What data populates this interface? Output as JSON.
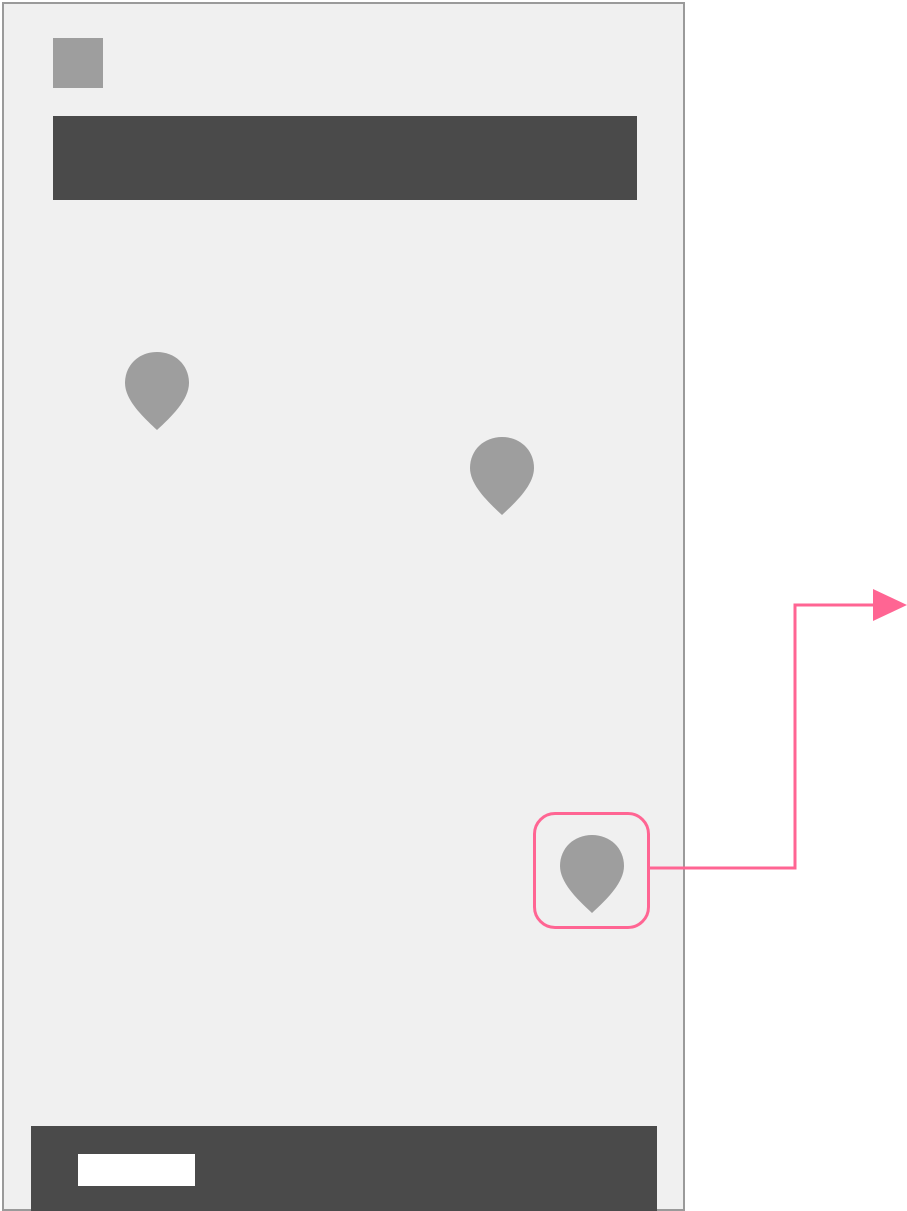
{
  "colors": {
    "screen_background": "#f0f0f0",
    "screen_border": "#9a9a9a",
    "dark_bar": "#4a4a4a",
    "placeholder_gray": "#9e9e9e",
    "highlight": "#ff6593",
    "button_fill": "#ffffff"
  },
  "icons": {
    "logo": "square-placeholder",
    "pin": "map-pin-icon",
    "arrow": "arrow-right-icon"
  },
  "map": {
    "pin_count": 3,
    "highlighted_pin_index": 2
  }
}
